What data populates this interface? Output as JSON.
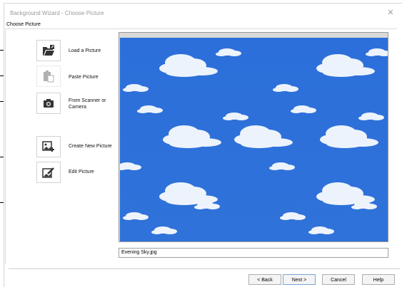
{
  "window": {
    "title": "Background Wizard - Choose Picture",
    "close_glyph": "✕"
  },
  "group": {
    "label": "Choose Picture"
  },
  "tools": [
    {
      "label": "Load a Picture",
      "icon": "folder-open-icon",
      "enabled": true
    },
    {
      "label": "Paste Picture",
      "icon": "clipboard-paste-icon",
      "enabled": false
    },
    {
      "label": "From Scanner or Camera",
      "icon": "camera-icon",
      "enabled": true
    },
    {
      "label": "Create New Picture",
      "icon": "new-picture-icon",
      "enabled": true
    },
    {
      "label": "Edit Picture",
      "icon": "edit-picture-icon",
      "enabled": true
    }
  ],
  "preview": {
    "filename": "Evening Sky.jpg",
    "sky_color": "#2a6fd8",
    "cloud_color": "#ffffff"
  },
  "buttons": {
    "back": "< Back",
    "next": "Next >",
    "cancel": "Cancel",
    "help": "Help"
  }
}
